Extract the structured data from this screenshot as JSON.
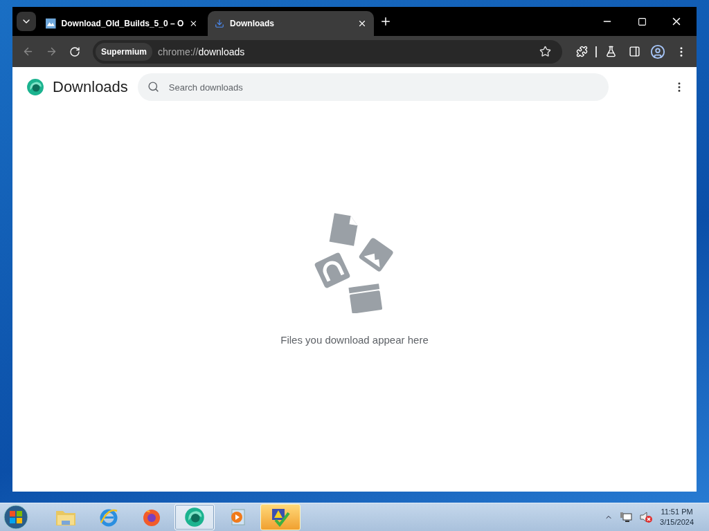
{
  "tabs": [
    {
      "title": "Download_Old_Builds_5_0 – O",
      "kind": "page",
      "selected": false
    },
    {
      "title": "Downloads",
      "kind": "download",
      "selected": true
    }
  ],
  "toolbar": {
    "chip": "Supermium",
    "url_scheme": "chrome://",
    "url_path": "downloads"
  },
  "page": {
    "title": "Downloads",
    "search": {
      "placeholder": "Search downloads"
    },
    "empty_message": "Files you download appear here"
  },
  "taskbar": {
    "apps": [
      {
        "kind": "folder",
        "selected": false,
        "flashing": false
      },
      {
        "kind": "ie",
        "selected": false,
        "flashing": false
      },
      {
        "kind": "firefox",
        "selected": false,
        "flashing": false
      },
      {
        "kind": "browser",
        "selected": true,
        "flashing": false
      },
      {
        "kind": "media",
        "selected": false,
        "flashing": false
      },
      {
        "kind": "alert",
        "selected": false,
        "flashing": true
      }
    ],
    "clock": {
      "time": "11:51 PM",
      "date": "3/15/2024"
    }
  }
}
